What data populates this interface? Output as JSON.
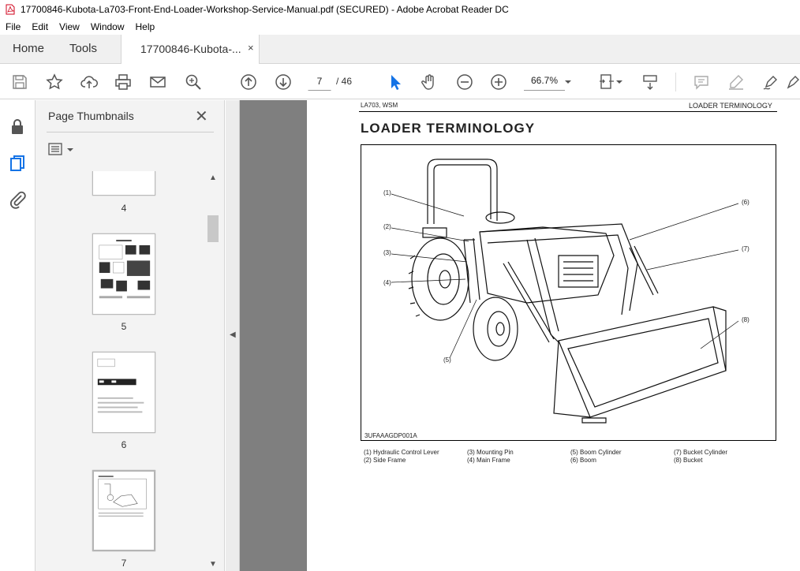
{
  "window": {
    "title": "17700846-Kubota-La703-Front-End-Loader-Workshop-Service-Manual.pdf (SECURED) - Adobe Acrobat Reader DC"
  },
  "menu": [
    "File",
    "Edit",
    "View",
    "Window",
    "Help"
  ],
  "tabs": {
    "home": "Home",
    "tools": "Tools",
    "document": "17700846-Kubota-...",
    "close": "×"
  },
  "toolbar": {
    "current_page": "7",
    "page_total": "/ 46",
    "zoom": "66.7%"
  },
  "thumbnails": {
    "title": "Page Thumbnails",
    "close": "✕",
    "pages": [
      "4",
      "5",
      "6",
      "7"
    ]
  },
  "document": {
    "header_left": "LA703, WSM",
    "header_right": "LOADER TERMINOLOGY",
    "heading": "LOADER  TERMINOLOGY",
    "figure_code": "3UFAAAGDP001A",
    "callouts": [
      "(1)",
      "(2)",
      "(3)",
      "(4)",
      "(5)",
      "(6)",
      "(7)",
      "(8)"
    ],
    "legend": [
      {
        "num": "(1)",
        "label": "Hydraulic Control Lever"
      },
      {
        "num": "(2)",
        "label": "Side Frame"
      },
      {
        "num": "(3)",
        "label": "Mounting Pin"
      },
      {
        "num": "(4)",
        "label": "Main Frame"
      },
      {
        "num": "(5)",
        "label": "Boom Cylinder"
      },
      {
        "num": "(6)",
        "label": "Boom"
      },
      {
        "num": "(7)",
        "label": "Bucket Cylinder"
      },
      {
        "num": "(8)",
        "label": "Bucket"
      }
    ]
  },
  "colors": {
    "accent": "#1473e6",
    "pdf_red": "#d0021b",
    "doc_background": "#7f7f7f"
  }
}
